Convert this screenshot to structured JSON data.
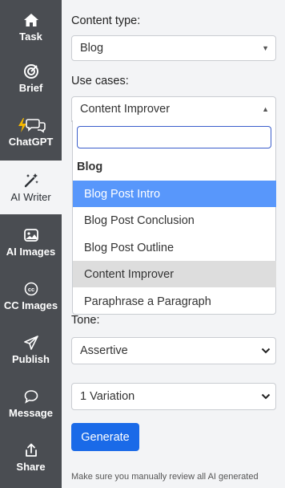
{
  "sidebar": {
    "items": [
      {
        "label": "Task",
        "icon": "home-icon"
      },
      {
        "label": "Brief",
        "icon": "target-icon"
      },
      {
        "label": "ChatGPT",
        "icon": "chat-bolt-icon"
      },
      {
        "label": "AI Writer",
        "icon": "magic-wand-icon"
      },
      {
        "label": "AI Images",
        "icon": "image-icon"
      },
      {
        "label": "CC Images",
        "icon": "cc-icon"
      },
      {
        "label": "Publish",
        "icon": "send-icon"
      },
      {
        "label": "Message",
        "icon": "message-icon"
      },
      {
        "label": "Share",
        "icon": "share-icon"
      }
    ],
    "active": "AI Writer"
  },
  "form": {
    "content_type_label": "Content type:",
    "content_type_value": "Blog",
    "use_cases_label": "Use cases:",
    "use_cases_value": "Content Improver",
    "tone_label": "Tone:",
    "tone_value": "Assertive",
    "variations_value": "1 Variation",
    "generate_label": "Generate",
    "footnote": "Make sure you manually review all AI generated"
  },
  "dropdown": {
    "search_value": "",
    "group_label": "Blog",
    "options": [
      {
        "label": "Blog Post Intro",
        "state": "highlighted"
      },
      {
        "label": "Blog Post Conclusion",
        "state": ""
      },
      {
        "label": "Blog Post Outline",
        "state": ""
      },
      {
        "label": "Content Improver",
        "state": "selected"
      },
      {
        "label": "Paraphrase a Paragraph",
        "state": ""
      }
    ]
  },
  "colors": {
    "sidebar_bg": "#4a4d52",
    "highlight": "#5897fb",
    "primary_button": "#1a6ae8",
    "bolt": "#f5b800"
  }
}
